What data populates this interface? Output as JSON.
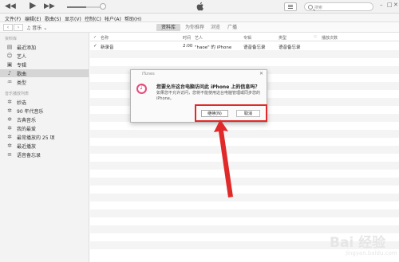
{
  "toolbar": {
    "volume_level": 0.55,
    "search_placeholder": "搜索"
  },
  "menu": [
    "文件(F)",
    "编辑(E)",
    "歌曲(S)",
    "显示(V)",
    "控制(C)",
    "帐户(A)",
    "帮助(H)"
  ],
  "nav": {
    "library": "音乐",
    "tabs": [
      "资料库",
      "为你推荐",
      "浏览",
      "广播"
    ]
  },
  "sidebar": {
    "library_title": "资料库",
    "library_items": [
      {
        "label": "最近添加",
        "icon": "clock-icon"
      },
      {
        "label": "艺人",
        "icon": "artist-icon"
      },
      {
        "label": "专辑",
        "icon": "album-icon"
      },
      {
        "label": "歌曲",
        "icon": "note-icon",
        "selected": true
      },
      {
        "label": "类型",
        "icon": "genre-icon"
      }
    ],
    "playlists_title": "音乐播放列表",
    "playlists": [
      {
        "label": "妙选",
        "icon": "gear-icon"
      },
      {
        "label": "90 年代音乐",
        "icon": "gear-icon"
      },
      {
        "label": "古典音乐",
        "icon": "gear-icon"
      },
      {
        "label": "我的最爱",
        "icon": "gear-icon"
      },
      {
        "label": "最常播放的 25 项",
        "icon": "gear-icon"
      },
      {
        "label": "最近播放",
        "icon": "gear-icon"
      },
      {
        "label": "语音备忘录",
        "icon": "list-icon"
      }
    ]
  },
  "table": {
    "headers": [
      "名称",
      "时间",
      "艺人",
      "专辑",
      "类型",
      "播放次数"
    ],
    "rows": [
      {
        "check": "✓",
        "name": "新录音",
        "time": "2:00",
        "artist": "\"haoe\" 的 iPhone",
        "album": "语音备忘录",
        "genre": "语音备忘录"
      }
    ]
  },
  "dialog": {
    "title": "iTunes",
    "heading": "您要允许这台电脑访问此 iPhone 上的信息吗？",
    "body": "如果您不允许访问，您将不能使用这台电脑管理或同步您的 iPhone。",
    "continue_label": "继续(N)",
    "cancel_label": "取消"
  },
  "watermark": {
    "text": "Bai 经验",
    "sub": "jingyan.baidu.com"
  }
}
